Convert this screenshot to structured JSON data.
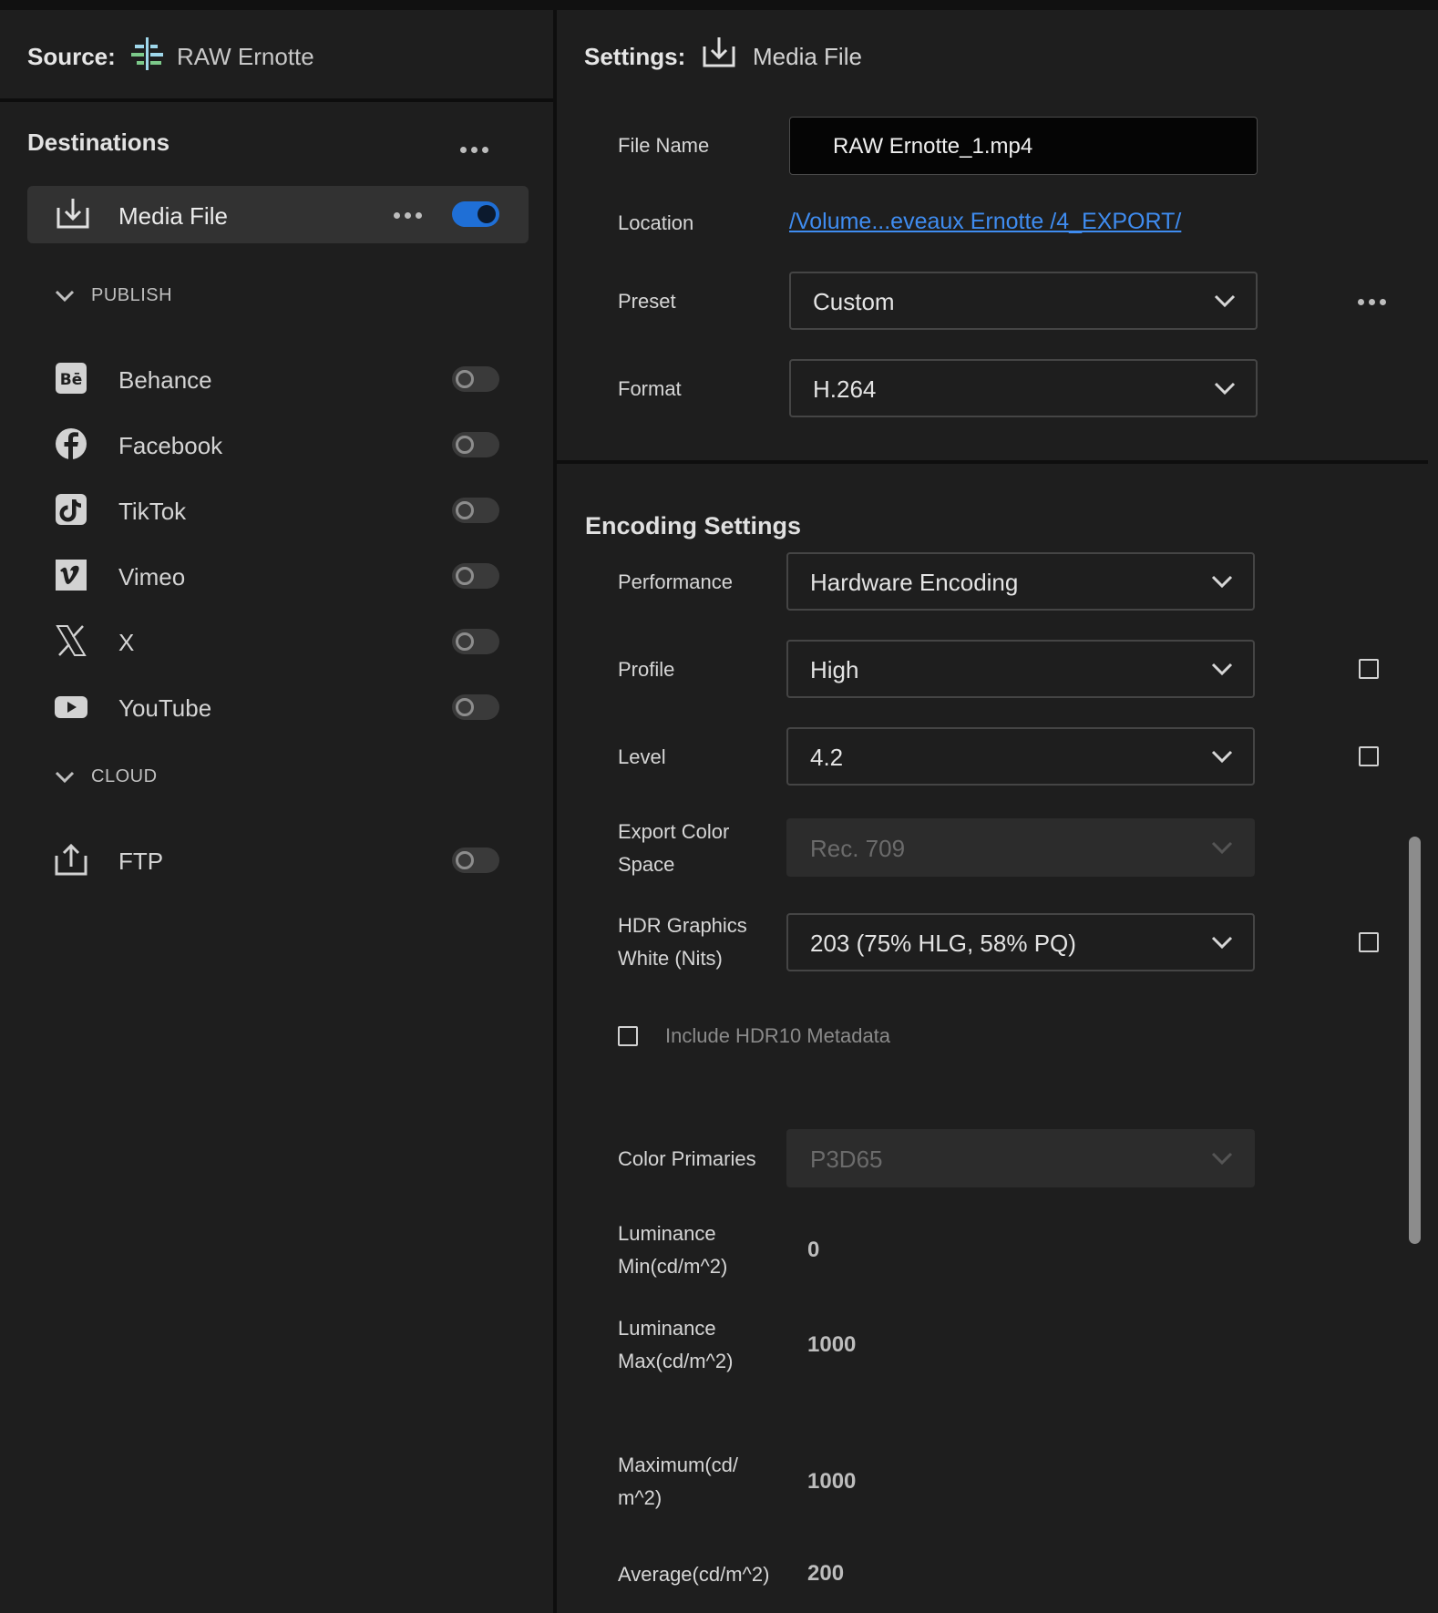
{
  "source": {
    "label": "Source:",
    "name": "RAW Ernotte",
    "icon": "sequence-icon"
  },
  "destinations": {
    "title": "Destinations",
    "media_file": {
      "label": "Media File",
      "enabled": true
    },
    "publish_header": "PUBLISH",
    "publish": [
      {
        "label": "Behance",
        "icon": "behance-icon",
        "enabled": false
      },
      {
        "label": "Facebook",
        "icon": "facebook-icon",
        "enabled": false
      },
      {
        "label": "TikTok",
        "icon": "tiktok-icon",
        "enabled": false
      },
      {
        "label": "Vimeo",
        "icon": "vimeo-icon",
        "enabled": false
      },
      {
        "label": "X",
        "icon": "x-icon",
        "enabled": false
      },
      {
        "label": "YouTube",
        "icon": "youtube-icon",
        "enabled": false
      }
    ],
    "cloud_header": "CLOUD",
    "cloud": [
      {
        "label": "FTP",
        "icon": "upload-icon",
        "enabled": false
      }
    ]
  },
  "settings": {
    "label": "Settings:",
    "target": "Media File",
    "file_name_label": "File Name",
    "file_name": "RAW Ernotte_1.mp4",
    "location_label": "Location",
    "location": "/Volume...eveaux Ernotte /4_EXPORT/",
    "preset_label": "Preset",
    "preset": "Custom",
    "format_label": "Format",
    "format": "H.264"
  },
  "encoding": {
    "title": "Encoding Settings",
    "performance_label": "Performance",
    "performance": "Hardware Encoding",
    "profile_label": "Profile",
    "profile": "High",
    "level_label": "Level",
    "level": "4.2",
    "export_color_space_label_1": "Export Color",
    "export_color_space_label_2": "Space",
    "export_color_space": "Rec. 709",
    "hdr_white_label_1": "HDR Graphics",
    "hdr_white_label_2": "White (Nits)",
    "hdr_white": "203 (75% HLG, 58% PQ)",
    "hdr10_label": "Include HDR10 Metadata",
    "hdr10_checked": false,
    "color_primaries_label": "Color Primaries",
    "color_primaries": "P3D65",
    "lum_min_label_1": "Luminance",
    "lum_min_label_2": "Min(cd/m^2)",
    "lum_min": "0",
    "lum_max_label_1": "Luminance",
    "lum_max_label_2": "Max(cd/m^2)",
    "lum_max": "1000",
    "maximum_label_1": "Maximum(cd/",
    "maximum_label_2": "m^2)",
    "maximum": "1000",
    "average_label": "Average(cd/m^2)",
    "average": "200"
  },
  "colors": {
    "accent": "#1f6fd6",
    "link": "#3f8cf0",
    "bg": "#1e1e1e"
  }
}
